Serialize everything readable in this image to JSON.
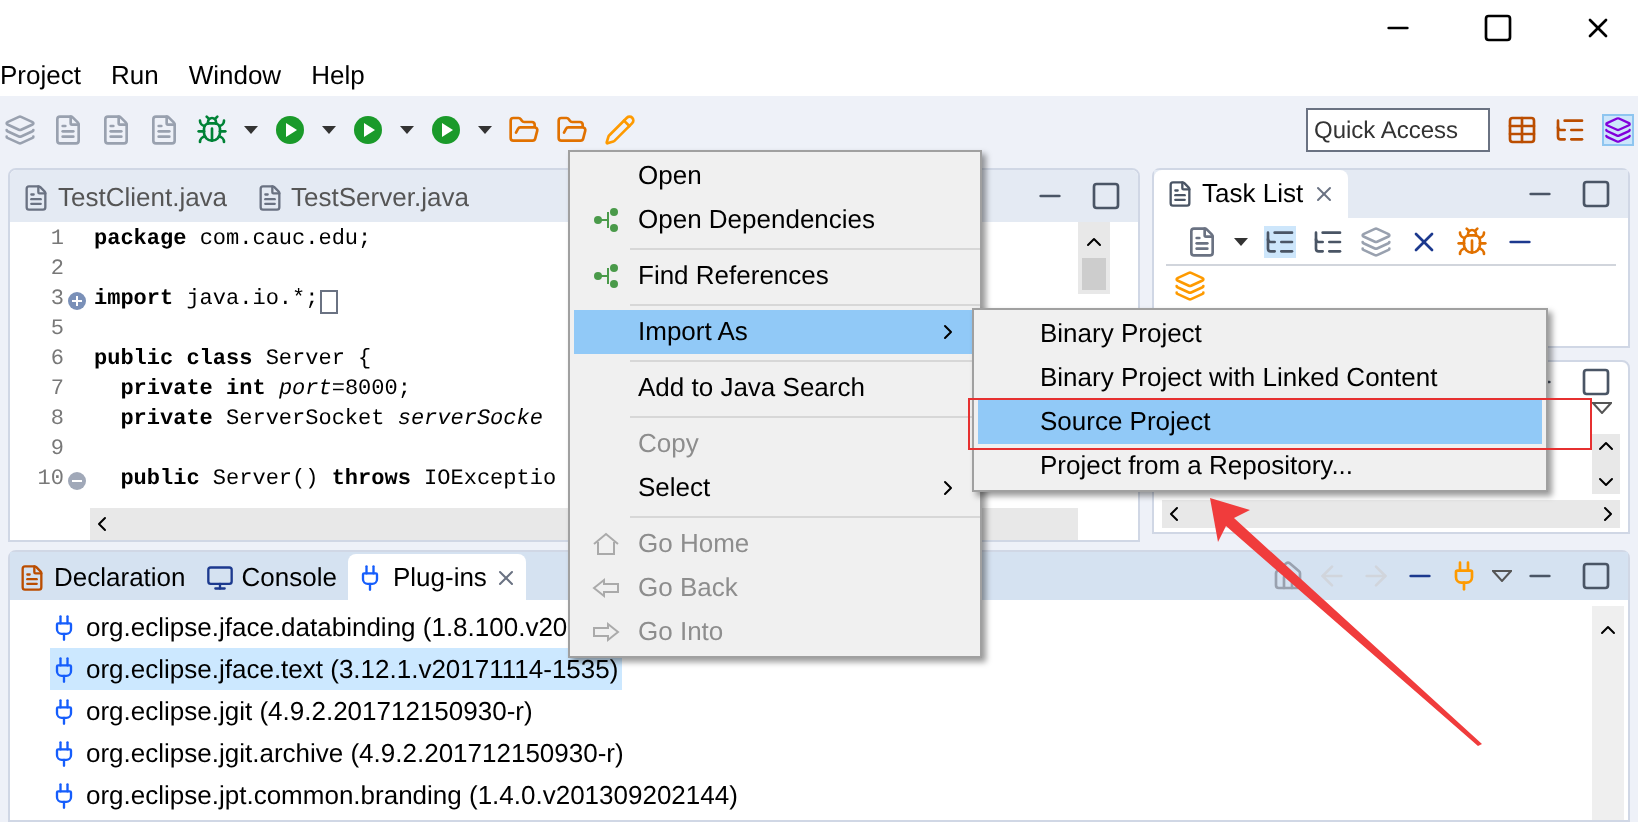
{
  "menubar": [
    "Project",
    "Run",
    "Window",
    "Help"
  ],
  "quick_access": {
    "placeholder": "Quick Access"
  },
  "editor": {
    "tabs": [
      {
        "label": "TestClient.java",
        "selected": false
      },
      {
        "label": "TestServer.java",
        "selected": false
      }
    ],
    "lines": [
      {
        "number": "1",
        "kind": "plain",
        "code": "**package** com.cauc.edu;"
      },
      {
        "number": "2",
        "kind": "plain"
      },
      {
        "number": "3",
        "kind": "folded",
        "code": "**import** java.io.*;"
      },
      {
        "number": "5",
        "kind": "plain"
      },
      {
        "number": "6",
        "kind": "plain",
        "code": "**public class** Server {"
      },
      {
        "number": "7",
        "kind": "plain",
        "code": "  **private int** *port*=8000;"
      },
      {
        "number": "8",
        "kind": "plain",
        "code": "  **private** ServerSocket *serverSocke*"
      },
      {
        "number": "9",
        "kind": "plain"
      },
      {
        "number": "10",
        "kind": "foldable",
        "code": "  **public** Server() **throws** IOExceptio"
      }
    ]
  },
  "task_list": {
    "title": "Task List"
  },
  "bottom_panel": {
    "tabs": [
      {
        "label": "Declaration",
        "selected": false
      },
      {
        "label": "Console",
        "selected": false
      },
      {
        "label": "Plug-ins",
        "selected": true
      }
    ],
    "rows": [
      {
        "text": "org.eclipse.jface.databinding (1.8.100.v20",
        "selected": false
      },
      {
        "text": "org.eclipse.jface.text (3.12.1.v20171114-1535)",
        "selected": true
      },
      {
        "text": "org.eclipse.jgit (4.9.2.201712150930-r)",
        "selected": false
      },
      {
        "text": "org.eclipse.jgit.archive (4.9.2.201712150930-r)",
        "selected": false
      },
      {
        "text": "org.eclipse.jpt.common.branding (1.4.0.v201309202144)",
        "selected": false
      }
    ]
  },
  "context_menu": [
    {
      "kind": "item",
      "label": "Open",
      "disabled": false,
      "selected": false,
      "submenu": false
    },
    {
      "kind": "item",
      "label": "Open Dependencies",
      "disabled": false,
      "selected": false,
      "submenu": false
    },
    {
      "kind": "separator"
    },
    {
      "kind": "item",
      "label": "Find References",
      "disabled": false,
      "selected": false,
      "submenu": false
    },
    {
      "kind": "separator"
    },
    {
      "kind": "item",
      "label": "Import As",
      "disabled": false,
      "selected": true,
      "submenu": true
    },
    {
      "kind": "separator"
    },
    {
      "kind": "item",
      "label": "Add to Java Search",
      "disabled": false,
      "selected": false,
      "submenu": false
    },
    {
      "kind": "separator"
    },
    {
      "kind": "item",
      "label": "Copy",
      "disabled": true,
      "selected": false,
      "submenu": false
    },
    {
      "kind": "item",
      "label": "Select",
      "disabled": false,
      "selected": false,
      "submenu": true
    },
    {
      "kind": "separator"
    },
    {
      "kind": "item",
      "label": "Go Home",
      "disabled": true,
      "selected": false,
      "submenu": false
    },
    {
      "kind": "item",
      "label": "Go Back",
      "disabled": true,
      "selected": false,
      "submenu": false
    },
    {
      "kind": "item",
      "label": "Go Into",
      "disabled": true,
      "selected": false,
      "submenu": false
    }
  ],
  "submenu": [
    {
      "label": "Binary Project",
      "selected": false
    },
    {
      "label": "Binary Project with Linked Content",
      "selected": false
    },
    {
      "label": "Source Project",
      "selected": true
    },
    {
      "label": "Project from a Repository...",
      "selected": false
    }
  ]
}
